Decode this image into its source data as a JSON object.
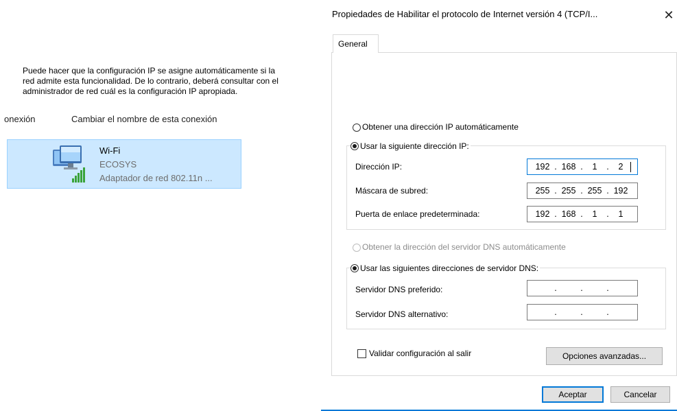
{
  "background": {
    "toolbar": {
      "partial_item": "onexión",
      "rename": "Cambiar el nombre de esta conexión"
    },
    "connection": {
      "name": "Wi-Fi",
      "network": "ECOSYS",
      "adapter": "Adaptador de red 802.11n ..."
    }
  },
  "dialog": {
    "title": "Propiedades de Habilitar el protocolo de Internet versión 4 (TCP/I...",
    "close_glyph": "✕",
    "tab": "General",
    "description": [
      "Puede hacer que la configuración IP se asigne automáticamente si la",
      "red admite esta funcionalidad. De lo contrario, deberá consultar con el",
      "administrador de red cuál es la configuración IP apropiada."
    ],
    "ip_auto_label": "Obtener una dirección IP automáticamente",
    "ip_manual_label": "Usar la siguiente dirección IP:",
    "ip_fields": {
      "ip_label": "Dirección IP:",
      "ip": [
        "192",
        "168",
        "1",
        "2"
      ],
      "mask_label": "Máscara de subred:",
      "mask": [
        "255",
        "255",
        "255",
        "192"
      ],
      "gateway_label": "Puerta de enlace predeterminada:",
      "gateway": [
        "192",
        "168",
        "1",
        "1"
      ]
    },
    "dns_auto_label": "Obtener la dirección del servidor DNS automáticamente",
    "dns_manual_label": "Usar las siguientes direcciones de servidor DNS:",
    "dns_fields": {
      "preferred_label": "Servidor DNS preferido:",
      "alternate_label": "Servidor DNS alternativo:",
      "dot": "."
    },
    "validate_label": "Validar configuración al salir",
    "advanced_button": "Opciones avanzadas...",
    "ok_button": "Aceptar",
    "cancel_button": "Cancelar"
  },
  "colors": {
    "selection_bg": "#cce8ff",
    "selection_border": "#99d1ff",
    "accent": "#0078d7"
  }
}
